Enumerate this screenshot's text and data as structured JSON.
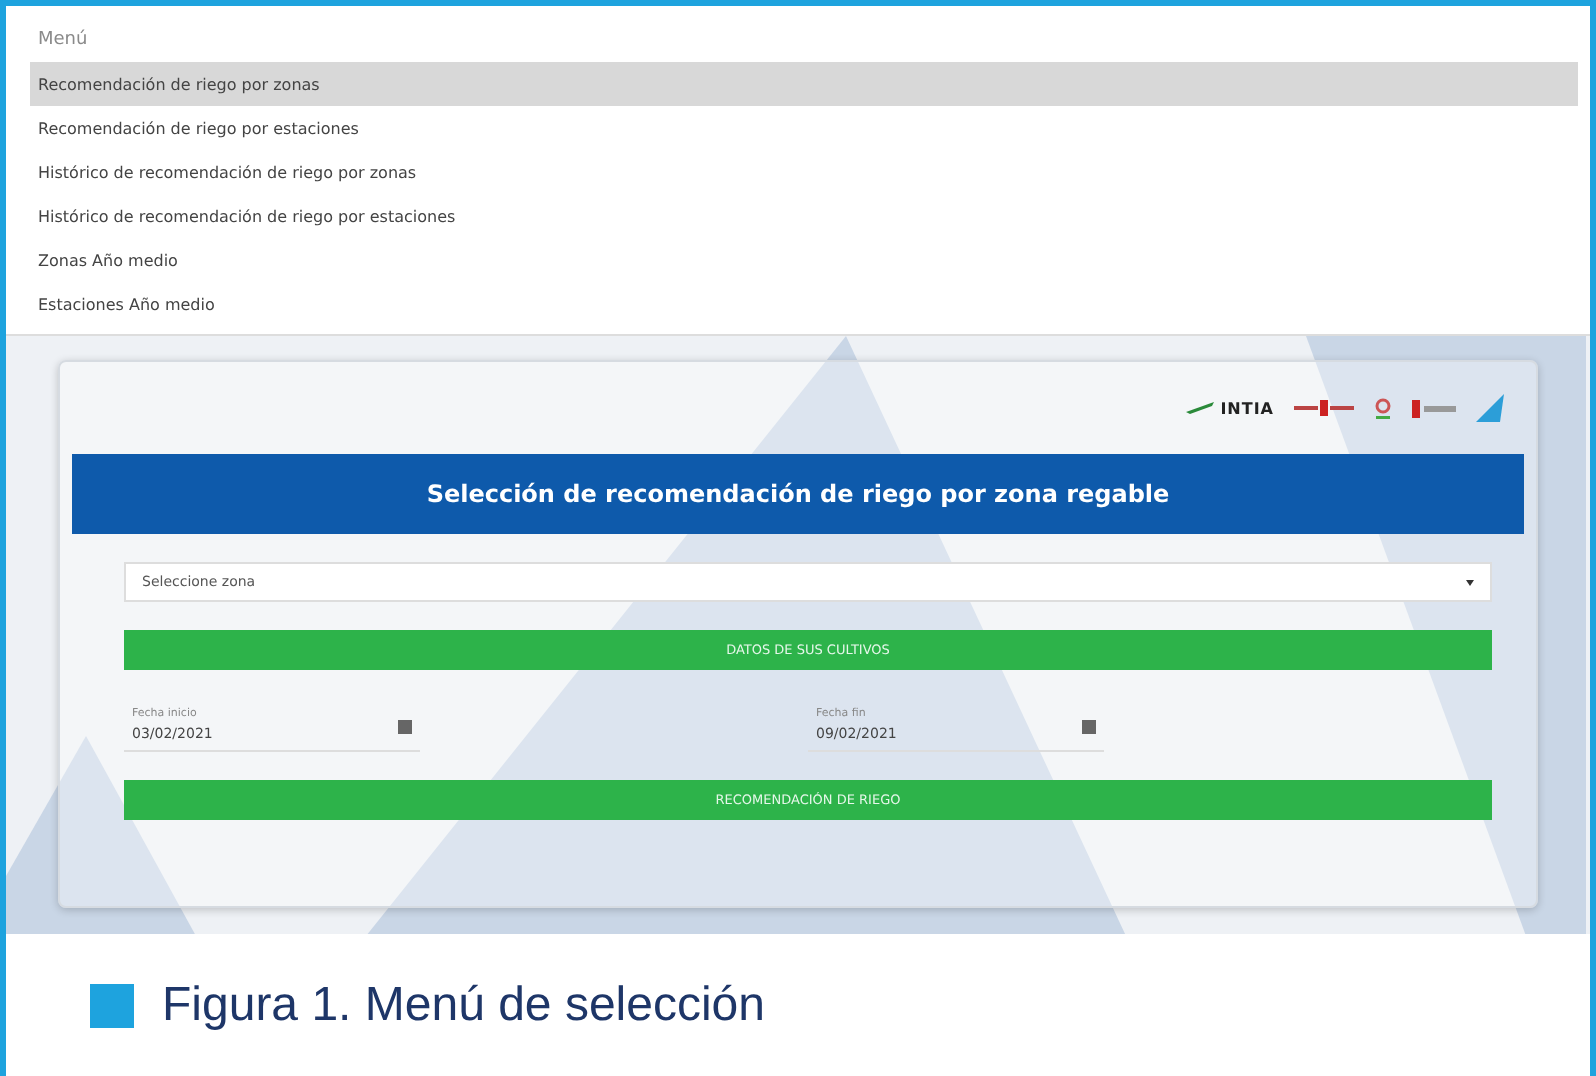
{
  "menu": {
    "title": "Menú",
    "items": [
      {
        "label": "Recomendación de riego por zonas",
        "selected": true
      },
      {
        "label": "Recomendación de riego por estaciones",
        "selected": false
      },
      {
        "label": "Histórico de recomendación de riego por zonas",
        "selected": false
      },
      {
        "label": "Histórico de recomendación de riego por estaciones",
        "selected": false
      },
      {
        "label": "Zonas Año medio",
        "selected": false
      },
      {
        "label": "Estaciones Año medio",
        "selected": false
      }
    ]
  },
  "logos": {
    "brand": "INTIA"
  },
  "banner": {
    "title": "Selección de recomendación de riego por zona regable"
  },
  "zone_select": {
    "value": "Seleccione zona"
  },
  "crops_button": {
    "label": "DATOS DE SUS CULTIVOS"
  },
  "dates": [
    {
      "label": "Fecha inicio",
      "value": "03/02/2021"
    },
    {
      "label": "Fecha fin",
      "value": "09/02/2021"
    }
  ],
  "recommend_button": {
    "label": "RECOMENDACIÓN DE RIEGO"
  },
  "caption": {
    "text": "Figura 1. Menú de selección"
  }
}
